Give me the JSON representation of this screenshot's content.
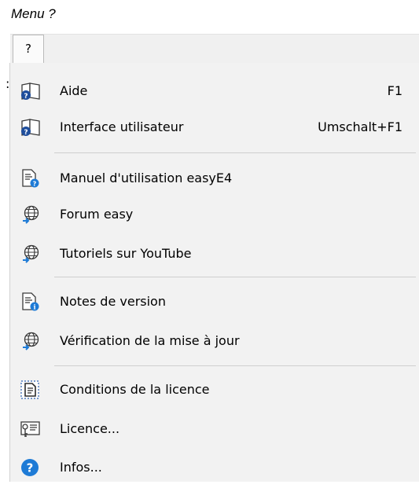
{
  "caption": "Menu ?",
  "menubar": {
    "help_label": "?"
  },
  "stray_text": ":",
  "menu": {
    "aide": {
      "label": "Aide",
      "shortcut": "F1",
      "icon": "help-book-icon"
    },
    "interface": {
      "label": "Interface utilisateur",
      "shortcut": "Umschalt+F1",
      "icon": "help-book-icon"
    },
    "manuel": {
      "label": "Manuel d'utilisation easyE4",
      "icon": "document-help-icon"
    },
    "forum": {
      "label": "Forum easy",
      "icon": "globe-link-icon"
    },
    "tutoriels": {
      "label": "Tutoriels sur YouTube",
      "icon": "globe-link-icon"
    },
    "notes": {
      "label": "Notes de version",
      "icon": "document-info-icon"
    },
    "verification": {
      "label": "Vérification de la mise à jour",
      "icon": "globe-link-icon"
    },
    "conditions": {
      "label": "Conditions de la licence",
      "icon": "license-document-icon"
    },
    "licence": {
      "label": "Licence...",
      "icon": "license-key-icon"
    },
    "infos": {
      "label": "Infos...",
      "icon": "question-circle-icon"
    }
  },
  "colors": {
    "accent_blue": "#1e7bd6",
    "menu_bg": "#f2f2f2",
    "separator": "#cfcfcf"
  }
}
